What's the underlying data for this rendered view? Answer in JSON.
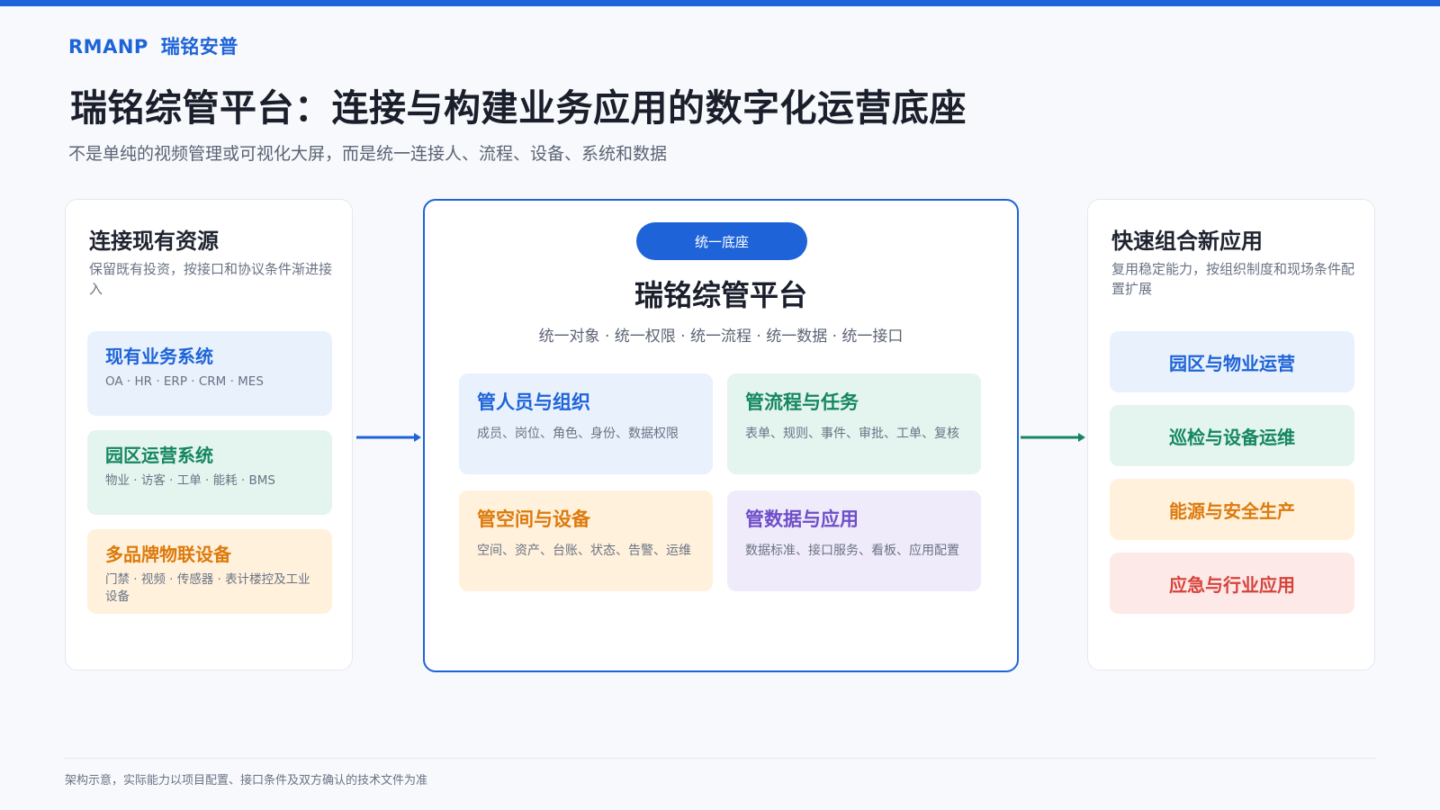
{
  "brand": {
    "en": "RMANP",
    "cn": "瑞铭安普"
  },
  "title": "瑞铭综管平台：连接与构建业务应用的数字化运营底座",
  "subtitle": "不是单纯的视频管理或可视化大屏，而是统一连接人、流程、设备、系统和数据",
  "left_card": {
    "title": "连接现有资源",
    "desc": "保留既有投资，按接口和协议条件渐进接入",
    "items": [
      {
        "title": "现有业务系统",
        "desc": "OA · HR · ERP · CRM · MES"
      },
      {
        "title": "园区运营系统",
        "desc": "物业 · 访客 · 工单 · 能耗 · BMS"
      },
      {
        "title": "多品牌物联设备",
        "desc": "门禁 · 视频 · 传感器 · 表计楼控及工业设备"
      }
    ]
  },
  "center_card": {
    "badge": "统一底座",
    "title": "瑞铭综管平台",
    "sub": "统一对象 · 统一权限 · 统一流程 · 统一数据 · 统一接口",
    "capabilities": [
      {
        "title": "管人员与组织",
        "desc": "成员、岗位、角色、身份、数据权限"
      },
      {
        "title": "管流程与任务",
        "desc": "表单、规则、事件、审批、工单、复核"
      },
      {
        "title": "管空间与设备",
        "desc": "空间、资产、台账、状态、告警、运维"
      },
      {
        "title": "管数据与应用",
        "desc": "数据标准、接口服务、看板、应用配置"
      }
    ]
  },
  "right_card": {
    "title": "快速组合新应用",
    "desc": "复用稳定能力，按组织制度和现场条件配置扩展",
    "apps": [
      "园区与物业运营",
      "巡检与设备运维",
      "能源与安全生产",
      "应急与行业应用"
    ]
  },
  "footnote": "架构示意，实际能力以项目配置、接口条件及双方确认的技术文件为准",
  "colors": {
    "primary": "#1e64d8",
    "green": "#14875f",
    "orange": "#dc7a0c",
    "red": "#d6433b",
    "purple": "#6f4ec9"
  }
}
